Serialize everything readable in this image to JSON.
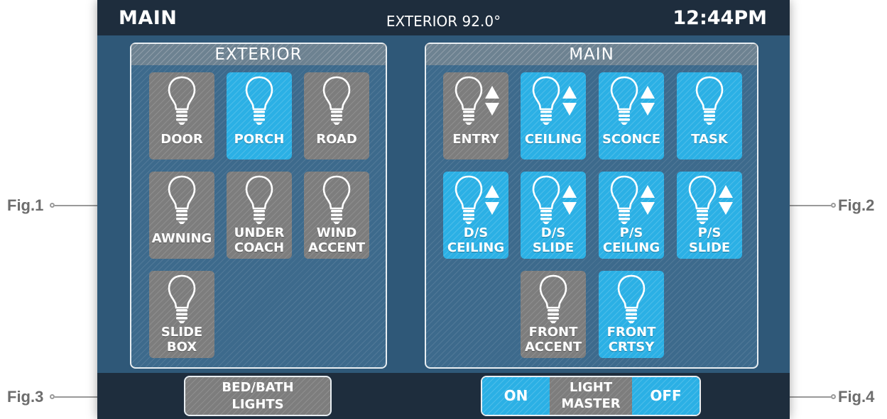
{
  "topbar": {
    "title": "MAIN",
    "exterior_temp": "EXTERIOR  92.0°",
    "time": "12:44PM"
  },
  "colors": {
    "on": "#2bb0e5",
    "off": "#7d7d7d",
    "screen_bg": "#2f5878",
    "bar_bg": "#1e2d3d"
  },
  "exterior": {
    "title": "EXTERIOR",
    "tiles": [
      {
        "label": "DOOR",
        "state": "off",
        "icon": "lightbulb-icon"
      },
      {
        "label": "PORCH",
        "state": "on",
        "icon": "lightbulb-icon"
      },
      {
        "label": "ROAD",
        "state": "off",
        "icon": "lightbulb-icon"
      },
      {
        "label": "AWNING",
        "state": "off",
        "icon": "lightbulb-icon"
      },
      {
        "label": "UNDER\nCOACH",
        "state": "off",
        "icon": "lightbulb-icon"
      },
      {
        "label": "WIND\nACCENT",
        "state": "off",
        "icon": "lightbulb-icon"
      },
      {
        "label": "SLIDE\nBOX",
        "state": "off",
        "icon": "lightbulb-icon"
      }
    ]
  },
  "main": {
    "title": "MAIN",
    "tiles": [
      {
        "label": "ENTRY",
        "state": "off",
        "dimmable": true
      },
      {
        "label": "CEILING",
        "state": "on",
        "dimmable": true
      },
      {
        "label": "SCONCE",
        "state": "on",
        "dimmable": true
      },
      {
        "label": "TASK",
        "state": "on",
        "dimmable": false
      },
      {
        "label": "D/S\nCEILING",
        "state": "on",
        "dimmable": true
      },
      {
        "label": "D/S\nSLIDE",
        "state": "on",
        "dimmable": true
      },
      {
        "label": "P/S\nCEILING",
        "state": "on",
        "dimmable": true
      },
      {
        "label": "P/S\nSLIDE",
        "state": "on",
        "dimmable": true
      },
      {
        "label": "FRONT\nACCENT",
        "state": "off",
        "dimmable": false
      },
      {
        "label": "FRONT\nCRTSY",
        "state": "on",
        "dimmable": false
      }
    ]
  },
  "bottom": {
    "bedbath": "BED/BATH\nLIGHTS",
    "master_on": "ON",
    "master_label": "LIGHT\nMASTER",
    "master_off": "OFF"
  },
  "figures": {
    "fig1": "Fig.1",
    "fig2": "Fig.2",
    "fig3": "Fig.3",
    "fig4": "Fig.4"
  }
}
